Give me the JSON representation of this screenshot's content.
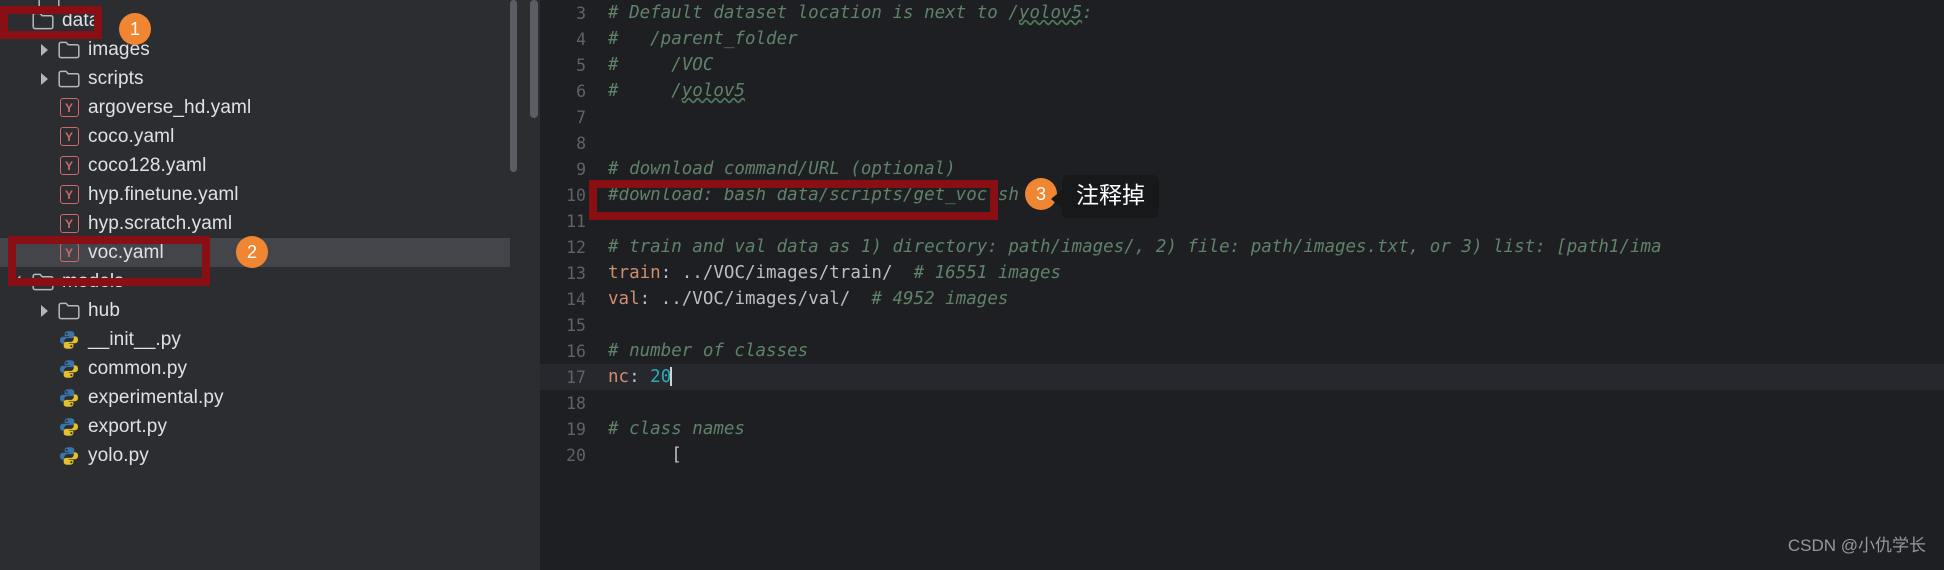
{
  "app": {
    "theme_bg": "#2b2d30",
    "editor_bg": "#1e1f22",
    "accent_orange": "#f08631",
    "annotation_red": "#8a0f14"
  },
  "sidebar": {
    "items": [
      {
        "label": "data",
        "icon": "folder-icon",
        "indent": 0,
        "expanded": true,
        "has_chevron": false,
        "partial_top": false
      },
      {
        "label": "images",
        "icon": "folder-icon",
        "indent": 1,
        "expanded": false,
        "has_chevron": true,
        "partial_top": false
      },
      {
        "label": "scripts",
        "icon": "folder-icon",
        "indent": 1,
        "expanded": false,
        "has_chevron": true,
        "partial_top": false
      },
      {
        "label": "argoverse_hd.yaml",
        "icon": "yaml-file-icon",
        "indent": 1,
        "expanded": false,
        "has_chevron": false,
        "partial_top": false
      },
      {
        "label": "coco.yaml",
        "icon": "yaml-file-icon",
        "indent": 1,
        "expanded": false,
        "has_chevron": false,
        "partial_top": false
      },
      {
        "label": "coco128.yaml",
        "icon": "yaml-file-icon",
        "indent": 1,
        "expanded": false,
        "has_chevron": false,
        "partial_top": false
      },
      {
        "label": "hyp.finetune.yaml",
        "icon": "yaml-file-icon",
        "indent": 1,
        "expanded": false,
        "has_chevron": false,
        "partial_top": false
      },
      {
        "label": "hyp.scratch.yaml",
        "icon": "yaml-file-icon",
        "indent": 1,
        "expanded": false,
        "has_chevron": false,
        "partial_top": false
      },
      {
        "label": "voc.yaml",
        "icon": "yaml-file-icon",
        "indent": 1,
        "expanded": false,
        "has_chevron": false,
        "partial_top": false,
        "selected": true
      },
      {
        "label": "models",
        "icon": "folder-icon",
        "indent": 0,
        "expanded": true,
        "has_chevron": true,
        "partial_top": false
      },
      {
        "label": "hub",
        "icon": "folder-icon",
        "indent": 1,
        "expanded": false,
        "has_chevron": true,
        "partial_top": false
      },
      {
        "label": "__init__.py",
        "icon": "python-file-icon",
        "indent": 1,
        "expanded": false,
        "has_chevron": false,
        "partial_top": false
      },
      {
        "label": "common.py",
        "icon": "python-file-icon",
        "indent": 1,
        "expanded": false,
        "has_chevron": false,
        "partial_top": false
      },
      {
        "label": "experimental.py",
        "icon": "python-file-icon",
        "indent": 1,
        "expanded": false,
        "has_chevron": false,
        "partial_top": false
      },
      {
        "label": "export.py",
        "icon": "python-file-icon",
        "indent": 1,
        "expanded": false,
        "has_chevron": false,
        "partial_top": false
      },
      {
        "label": "yolo.py",
        "icon": "python-file-icon",
        "indent": 1,
        "expanded": false,
        "has_chevron": false,
        "partial_top": false
      }
    ]
  },
  "editor": {
    "language": "yaml",
    "current_line": 17,
    "lines": [
      {
        "n": "3",
        "tokens": [
          {
            "t": "cmt",
            "v": "# Default dataset location is next to /"
          },
          {
            "t": "cmt-squig",
            "v": "yolov5"
          },
          {
            "t": "cmt",
            "v": ":"
          }
        ]
      },
      {
        "n": "4",
        "tokens": [
          {
            "t": "cmt",
            "v": "#   /parent_folder"
          }
        ]
      },
      {
        "n": "5",
        "tokens": [
          {
            "t": "cmt",
            "v": "#     /VOC"
          }
        ]
      },
      {
        "n": "6",
        "tokens": [
          {
            "t": "cmt",
            "v": "#     /"
          },
          {
            "t": "cmt-squig",
            "v": "yolov5"
          }
        ]
      },
      {
        "n": "7",
        "tokens": []
      },
      {
        "n": "8",
        "tokens": []
      },
      {
        "n": "9",
        "tokens": [
          {
            "t": "cmt",
            "v": "# download command/URL (optional)"
          }
        ]
      },
      {
        "n": "10",
        "tokens": [
          {
            "t": "cmt",
            "v": "#download: bash data/scripts/get_voc.sh"
          }
        ]
      },
      {
        "n": "11",
        "tokens": []
      },
      {
        "n": "12",
        "tokens": [
          {
            "t": "cmt",
            "v": "# train and val data as 1) directory: path/images/, 2) file: path/images.txt, or 3) list: [path1/ima"
          }
        ]
      },
      {
        "n": "13",
        "tokens": [
          {
            "t": "key",
            "v": "train"
          },
          {
            "t": "plain",
            "v": ": "
          },
          {
            "t": "val",
            "v": "../VOC/images/train/"
          },
          {
            "t": "plain",
            "v": "  "
          },
          {
            "t": "cmt",
            "v": "# 16551 images"
          }
        ]
      },
      {
        "n": "14",
        "tokens": [
          {
            "t": "key",
            "v": "val"
          },
          {
            "t": "plain",
            "v": ": "
          },
          {
            "t": "val",
            "v": "../VOC/images/val/"
          },
          {
            "t": "plain",
            "v": "  "
          },
          {
            "t": "cmt",
            "v": "# 4952 images"
          }
        ]
      },
      {
        "n": "15",
        "tokens": []
      },
      {
        "n": "16",
        "tokens": [
          {
            "t": "cmt",
            "v": "# number of classes"
          }
        ]
      },
      {
        "n": "17",
        "tokens": [
          {
            "t": "key",
            "v": "nc"
          },
          {
            "t": "plain",
            "v": ": "
          },
          {
            "t": "num",
            "v": "20"
          },
          {
            "t": "caret",
            "v": ""
          }
        ]
      },
      {
        "n": "18",
        "tokens": []
      },
      {
        "n": "19",
        "tokens": [
          {
            "t": "cmt",
            "v": "# class names"
          }
        ]
      },
      {
        "n": "20",
        "tokens": [
          {
            "t": "plain",
            "v": "      ["
          }
        ]
      }
    ]
  },
  "annotations": {
    "badges": [
      {
        "id": "1",
        "label": "1"
      },
      {
        "id": "2",
        "label": "2"
      },
      {
        "id": "3",
        "label": "3"
      }
    ],
    "callout_3": "注释掉"
  },
  "watermark": "CSDN @小仇学长"
}
